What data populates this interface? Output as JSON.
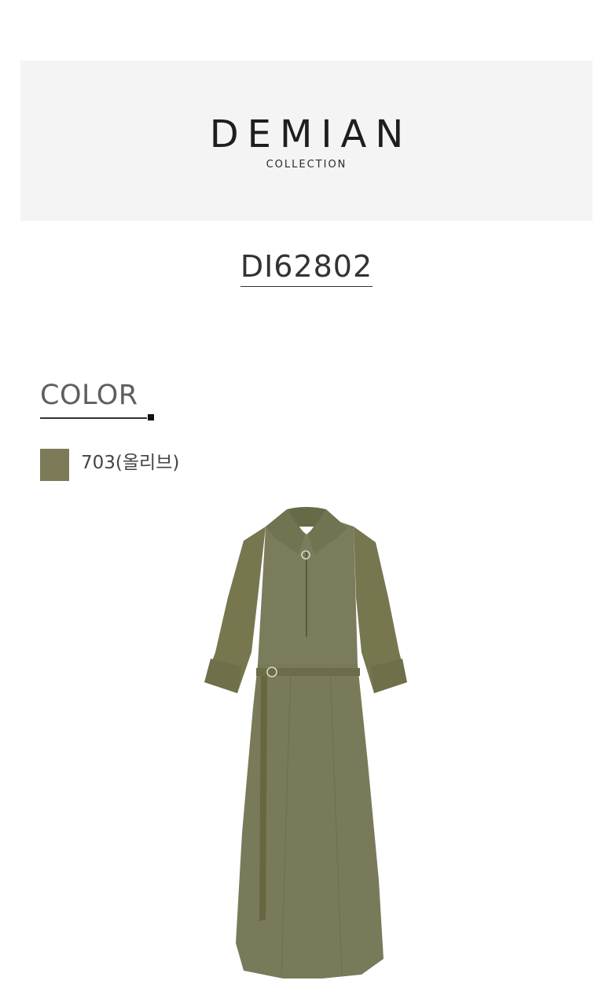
{
  "brand": {
    "name": "DEMIAN",
    "sub": "COLLECTION"
  },
  "product": {
    "code": "DI62802"
  },
  "color_section": {
    "heading": "COLOR",
    "options": [
      {
        "label": "703(올리브)",
        "hex": "#7d7a57"
      }
    ]
  },
  "image": {
    "subject": "dress-image",
    "accent": "#7b7c5b"
  }
}
